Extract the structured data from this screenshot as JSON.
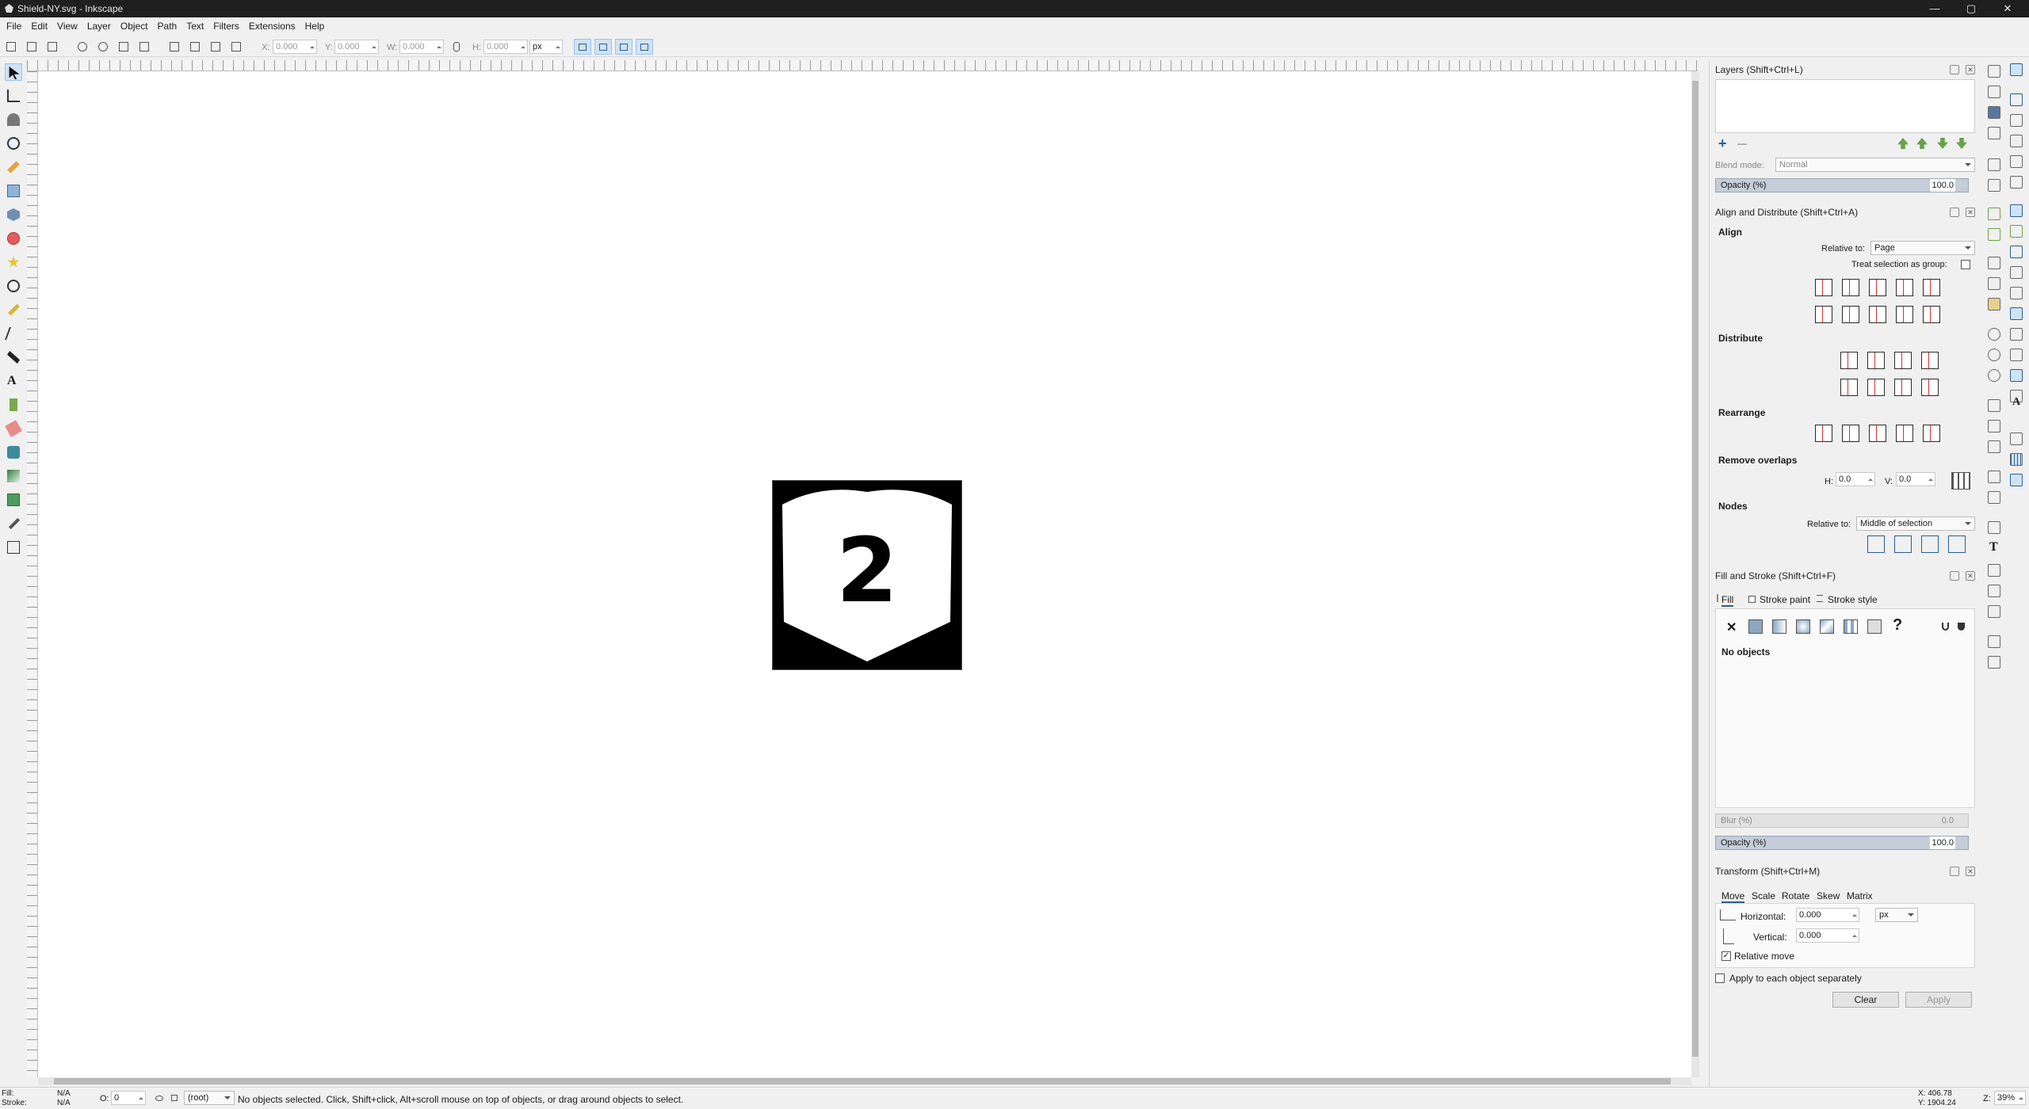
{
  "window": {
    "title": "Shield-NY.svg - Inkscape",
    "minimize": "—",
    "maximize": "▢",
    "close": "✕"
  },
  "menu": [
    "File",
    "Edit",
    "View",
    "Layer",
    "Object",
    "Path",
    "Text",
    "Filters",
    "Extensions",
    "Help"
  ],
  "toolbar": {
    "x_label": "X:",
    "x_value": "0.000",
    "y_label": "Y:",
    "y_value": "0.000",
    "w_label": "W:",
    "w_value": "0.000",
    "h_label": "H:",
    "h_value": "0.000",
    "unit": "px"
  },
  "canvas": {
    "shield_number": "2"
  },
  "layers": {
    "title": "Layers (Shift+Ctrl+L)",
    "blend_label": "Blend mode:",
    "blend_value": "Normal",
    "opacity_label": "Opacity (%)",
    "opacity_value": "100.0",
    "add": "+",
    "remove": "—"
  },
  "align": {
    "title": "Align and Distribute (Shift+Ctrl+A)",
    "align": "Align",
    "relative_label": "Relative to:",
    "relative_value": "Page",
    "treat_group": "Treat selection as group:",
    "distribute": "Distribute",
    "rearrange": "Rearrange",
    "remove_overlaps": "Remove overlaps",
    "h_label": "H:",
    "h_value": "0.0",
    "v_label": "V:",
    "v_value": "0.0",
    "nodes": "Nodes",
    "nodes_relative_label": "Relative to:",
    "nodes_relative_value": "Middle of selection"
  },
  "fill_stroke": {
    "title": "Fill and Stroke (Shift+Ctrl+F)",
    "tab_fill": "Fill",
    "tab_stroke_paint": "Stroke paint",
    "tab_stroke_style": "Stroke style",
    "no_paint": "✕",
    "unset": "?",
    "status": "No objects",
    "blur_label": "Blur (%)",
    "blur_value": "0.0",
    "opacity_label": "Opacity (%)",
    "opacity_value": "100.0"
  },
  "transform": {
    "title": "Transform (Shift+Ctrl+M)",
    "tabs": [
      "Move",
      "Scale",
      "Rotate",
      "Skew",
      "Matrix"
    ],
    "horizontal_label": "Horizontal:",
    "horizontal_value": "0.000",
    "vertical_label": "Vertical:",
    "vertical_value": "0.000",
    "unit": "px",
    "relative_move": "Relative move",
    "relative_move_checked": "✓",
    "apply_each": "Apply to each object separately",
    "clear": "Clear",
    "apply": "Apply"
  },
  "status": {
    "fill_label": "Fill:",
    "fill_value": "N/A",
    "stroke_label": "Stroke:",
    "stroke_value": "N/A",
    "o_label": "O:",
    "o_value": "0",
    "layer": "(root)",
    "message": "No objects selected. Click, Shift+click, Alt+scroll mouse on top of objects, or drag around objects to select.",
    "x_coord": "X: 406.78",
    "y_coord": "Y: 1904.24",
    "z_label": "Z:",
    "zoom": "39%"
  }
}
